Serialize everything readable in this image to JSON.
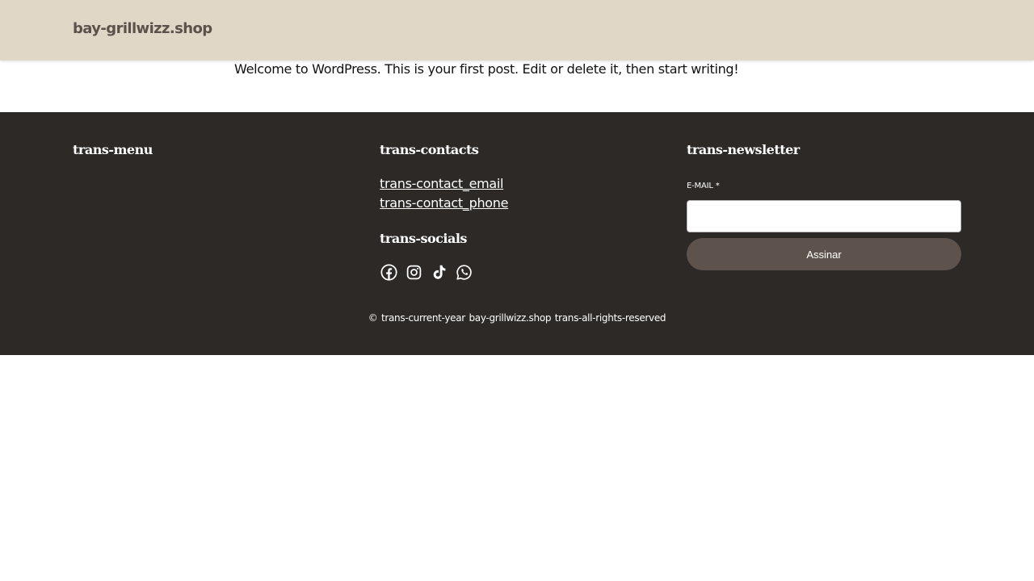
{
  "header": {
    "site_title": "bay-grillwizz.shop"
  },
  "post": {
    "content": "Welcome to WordPress. This is your first post. Edit or delete it, then start writing!"
  },
  "footer": {
    "menu_heading": "trans-menu",
    "contacts_heading": "trans-contacts",
    "contact_email": "trans-contact_email",
    "contact_phone": "trans-contact_phone",
    "socials_heading": "trans-socials",
    "socials": [
      "facebook-icon",
      "instagram-icon",
      "tiktok-icon",
      "whatsapp-icon"
    ],
    "newsletter_heading": "trans-newsletter",
    "email_label": "E-MAIL *",
    "email_value": "",
    "subscribe_label": "Assinar",
    "copyright_symbol": "©",
    "copyright_year": "trans-current-year",
    "copyright_site": "bay-grillwizz.shop",
    "copyright_rights": "trans-all-rights-reserved"
  },
  "colors": {
    "header_bg": "#e0d7c6",
    "footer_bg": "#2c2927",
    "button_bg": "#5e534c",
    "title_color": "#5c524b"
  }
}
